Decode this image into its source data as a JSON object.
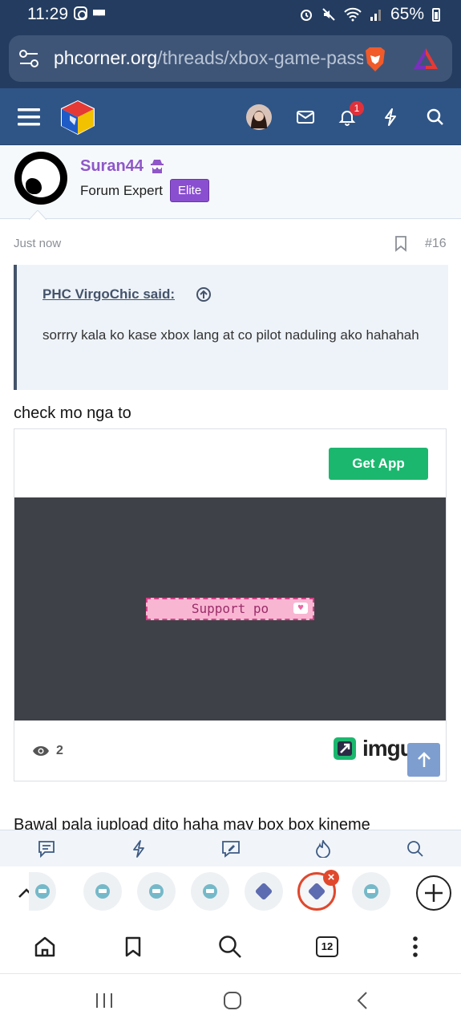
{
  "status_bar": {
    "time": "11:29",
    "battery": "65%"
  },
  "browser": {
    "url_domain": "phcorner.org",
    "url_path": "/threads/xbox-game-pass"
  },
  "site_header": {
    "notification_count": "1"
  },
  "post": {
    "author": "Suran44",
    "author_title": "Forum Expert",
    "badge": "Elite",
    "time": "Just now",
    "number": "#16",
    "quote": {
      "author": "PHC VirgoChic said:",
      "text": "sorrry kala ko kase xbox lang at co pilot naduling ako hahahah"
    },
    "message": "check mo nga to",
    "embed": {
      "get_app_label": "Get App",
      "image_text": "Support po",
      "view_count": "2",
      "brand": "imgur"
    },
    "next_message": "Bawal pala iupload dito haha may box box kineme"
  },
  "browser_toolbar": {
    "tab_count": "12"
  },
  "icons": {
    "menu": "menu-icon",
    "site_logo": "cube-logo-icon",
    "mail": "mail-icon",
    "bell": "bell-icon",
    "bolt": "bolt-icon",
    "search": "search-icon"
  },
  "colors": {
    "header": "#2f5586",
    "status_bar": "#233c60",
    "username": "#8f57c8",
    "elite_badge": "#8a4fd1",
    "get_app": "#1bb76e",
    "active_tab_ring": "#e0482d"
  }
}
